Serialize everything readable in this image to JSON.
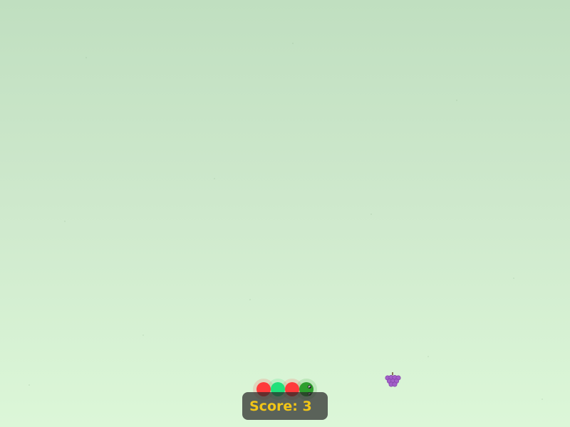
{
  "game": {
    "score_text": "Score: 3",
    "score_value": 3
  },
  "snake": {
    "segments": [
      {
        "role": "body",
        "color": "#ff3b3b"
      },
      {
        "role": "body",
        "color": "#20e07a"
      },
      {
        "role": "body",
        "color": "#ff3b3b"
      },
      {
        "role": "head",
        "color": "#2e9e2e"
      }
    ]
  },
  "fruit": {
    "icon": "grapes-icon",
    "color": "#a35fc9"
  },
  "colors": {
    "background_top": "#c0dfc0",
    "background_bottom": "#dcf7d8",
    "score_text": "#f2c617",
    "score_panel": "#282828"
  }
}
